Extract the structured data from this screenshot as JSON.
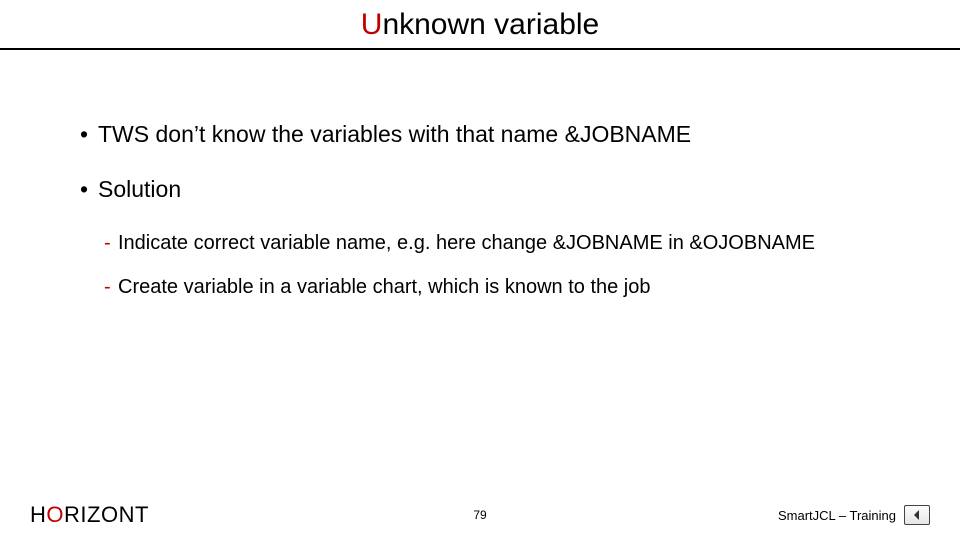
{
  "title": {
    "pre": "U",
    "post": "nknown variable"
  },
  "bullets": {
    "b1a": "TWS don’t know the variables with that name &JOBNAME",
    "b1b": "Solution",
    "b2a": "Indicate correct variable name, e.g. here change &JOBNAME in &OJOBNAME",
    "b2b": "Create variable in a variable chart, which is known to the job"
  },
  "footer": {
    "logo_pre": "H",
    "logo_accent": "O",
    "logo_post": "RIZONT",
    "page": "79",
    "course": "SmartJCL – Training"
  }
}
